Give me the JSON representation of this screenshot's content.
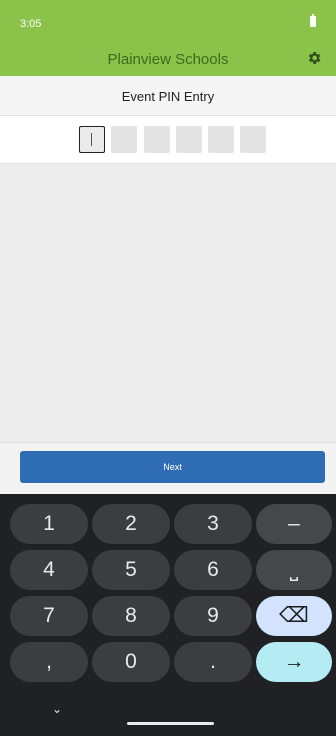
{
  "status": {
    "time": "3:05"
  },
  "appbar": {
    "title": "Plainview Schools",
    "settings_icon": "gear-icon"
  },
  "screen": {
    "heading": "Event PIN Entry"
  },
  "pin": {
    "length": 6,
    "filled": 0,
    "active_index": 0
  },
  "actions": {
    "next_label": "Next"
  },
  "keyboard": {
    "row1": [
      "1",
      "2",
      "3",
      "–"
    ],
    "row2": [
      "4",
      "5",
      "6",
      "⎵"
    ],
    "row3": [
      "7",
      "8",
      "9",
      "⌫"
    ],
    "row4": [
      ",",
      "0",
      ".",
      "→"
    ]
  },
  "colors": {
    "accent": "#8bc34a",
    "primary": "#2e6db4",
    "keyboard_bg": "#202124"
  }
}
